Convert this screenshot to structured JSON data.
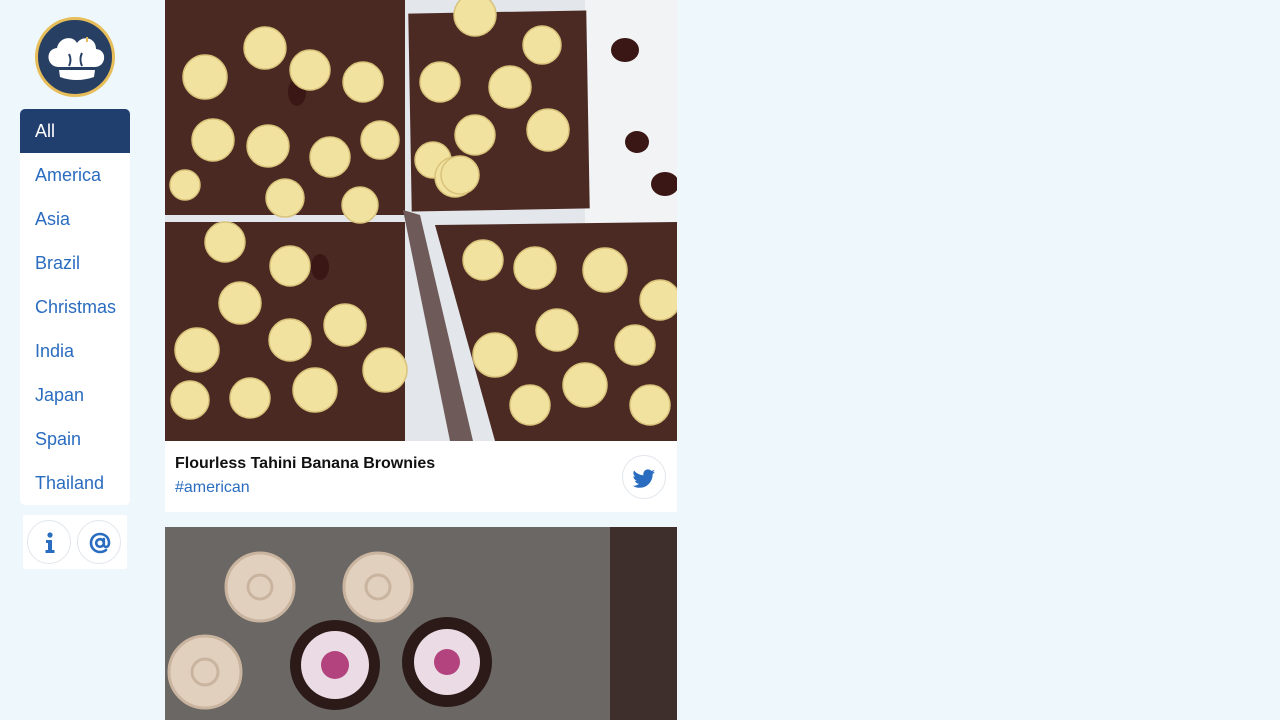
{
  "logo": {
    "icon": "chef-hat-icon",
    "colors": {
      "fill": "#273f63",
      "ring": "#e6bd59"
    }
  },
  "nav": {
    "active_index": 0,
    "items": [
      {
        "label": "All"
      },
      {
        "label": "America"
      },
      {
        "label": "Asia"
      },
      {
        "label": "Brazil"
      },
      {
        "label": "Christmas"
      },
      {
        "label": "India"
      },
      {
        "label": "Japan"
      },
      {
        "label": "Spain"
      },
      {
        "label": "Thailand"
      }
    ]
  },
  "social_links": [
    {
      "icon": "info-icon"
    },
    {
      "icon": "at-sign-icon"
    }
  ],
  "feed": {
    "cards": [
      {
        "title": "Flourless Tahini Banana Brownies",
        "tag": "#american",
        "image": "banana-brownies-photo",
        "share_icon": "twitter-icon"
      },
      {
        "image": "cupcakes-photo"
      }
    ]
  },
  "colors": {
    "background": "#eef7fc",
    "accent": "#2a6cbf",
    "active_nav": "#213f6e"
  }
}
